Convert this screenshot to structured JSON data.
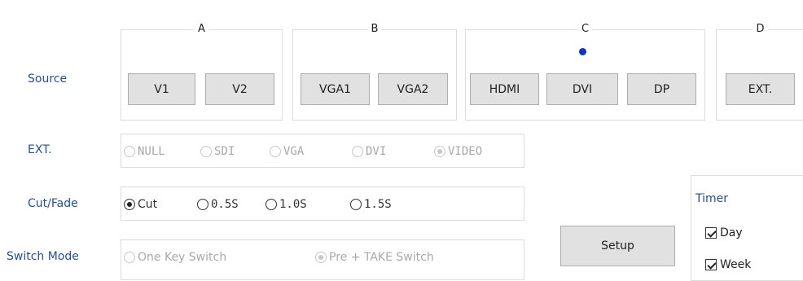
{
  "source_label": "Source",
  "groups": {
    "a": {
      "title": "A",
      "buttons": [
        "V1",
        "V2"
      ]
    },
    "b": {
      "title": "B",
      "buttons": [
        "VGA1",
        "VGA2"
      ]
    },
    "c": {
      "title": "C",
      "buttons": [
        "HDMI",
        "DVI",
        "DP"
      ]
    },
    "d": {
      "title": "D",
      "buttons": [
        "EXT."
      ]
    }
  },
  "ext": {
    "label": "EXT.",
    "options": [
      "NULL",
      "SDI",
      "VGA",
      "DVI",
      "VIDEO"
    ],
    "selected": "VIDEO",
    "enabled": false
  },
  "cutfade": {
    "label": "Cut/Fade",
    "options": [
      "Cut",
      "0.5S",
      "1.0S",
      "1.5S"
    ],
    "selected": "Cut"
  },
  "switch_mode": {
    "label": "Switch Mode",
    "options": [
      "One Key Switch",
      "Pre + TAKE Switch"
    ],
    "selected": "Pre + TAKE Switch",
    "enabled": false
  },
  "setup_button": "Setup",
  "timer": {
    "title": "Timer",
    "day": {
      "label": "Day",
      "checked": true
    },
    "week": {
      "label": "Week",
      "checked": true
    }
  },
  "colors": {
    "label_blue": "#1f4fa8",
    "indicator_dot": "#1030d0"
  }
}
